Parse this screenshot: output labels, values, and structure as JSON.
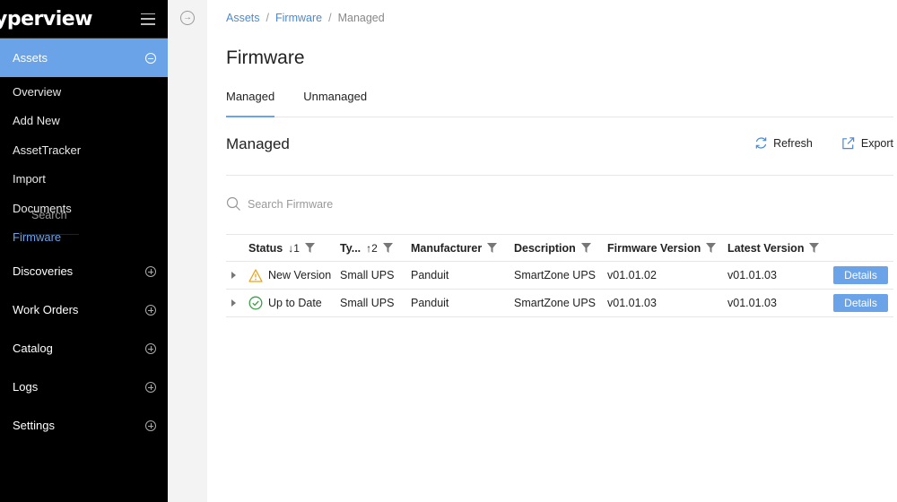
{
  "sidebar": {
    "logo": "yperview",
    "search_label": "Search",
    "active_section": "Assets",
    "sub_items": [
      "Overview",
      "Add New",
      "AssetTracker",
      "Import",
      "Documents",
      "Firmware"
    ],
    "sections": [
      "Discoveries",
      "Work Orders",
      "Catalog",
      "Logs",
      "Settings"
    ],
    "accent_color": "#6aa3e8"
  },
  "breadcrumb": {
    "items": [
      "Assets",
      "Firmware",
      "Managed"
    ],
    "separator": "/"
  },
  "page": {
    "title": "Firmware",
    "tabs": [
      "Managed",
      "Unmanaged"
    ],
    "section_title": "Managed",
    "actions": {
      "refresh": "Refresh",
      "export": "Export"
    },
    "search_placeholder": "Search Firmware"
  },
  "table": {
    "columns": {
      "status": "Status",
      "status_sort": "1",
      "type": "Ty...",
      "type_sort": "2",
      "manufacturer": "Manufacturer",
      "description": "Description",
      "firmware_version": "Firmware Version",
      "latest_version": "Latest Version"
    },
    "rows": [
      {
        "status": "New Version",
        "status_icon": "warning-icon",
        "type": "Small UPS",
        "manufacturer": "Panduit",
        "description": "SmartZone UPS",
        "firmware_version": "v01.01.02",
        "latest_version": "v01.01.03",
        "action": "Details"
      },
      {
        "status": "Up to Date",
        "status_icon": "check-circle-icon",
        "type": "Small UPS",
        "manufacturer": "Panduit",
        "description": "SmartZone UPS",
        "firmware_version": "v01.01.03",
        "latest_version": "v01.01.03",
        "action": "Details"
      }
    ]
  }
}
